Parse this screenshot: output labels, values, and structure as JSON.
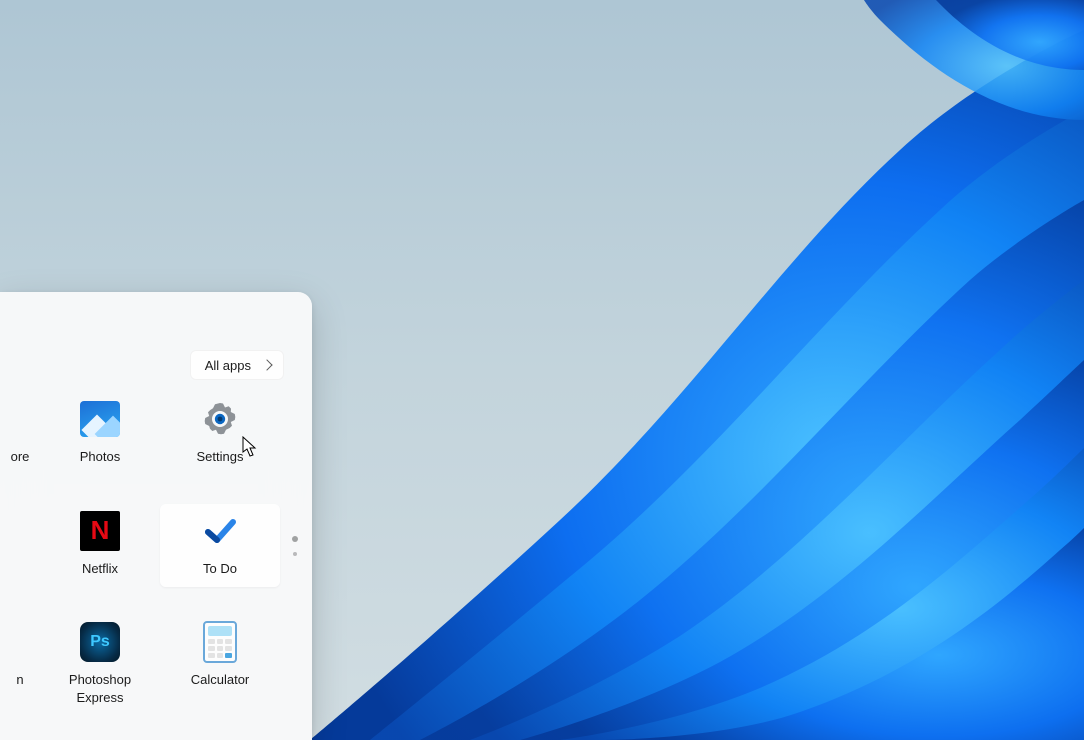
{
  "startMenu": {
    "allApps": {
      "label": "All apps"
    },
    "partial": {
      "row1Label": "ore",
      "row2Label": "",
      "row3Label": "n"
    },
    "apps": {
      "photos": {
        "label": "Photos",
        "iconName": "photos-icon"
      },
      "settings": {
        "label": "Settings",
        "iconName": "settings-gear-icon"
      },
      "netflix": {
        "label": "Netflix",
        "iconName": "netflix-icon",
        "glyph": "N"
      },
      "todo": {
        "label": "To Do",
        "iconName": "todo-check-icon"
      },
      "psexpress": {
        "label": "Photoshop Express",
        "iconName": "photoshop-express-icon",
        "glyph": "Ps"
      },
      "calc": {
        "label": "Calculator",
        "iconName": "calculator-icon"
      }
    }
  }
}
